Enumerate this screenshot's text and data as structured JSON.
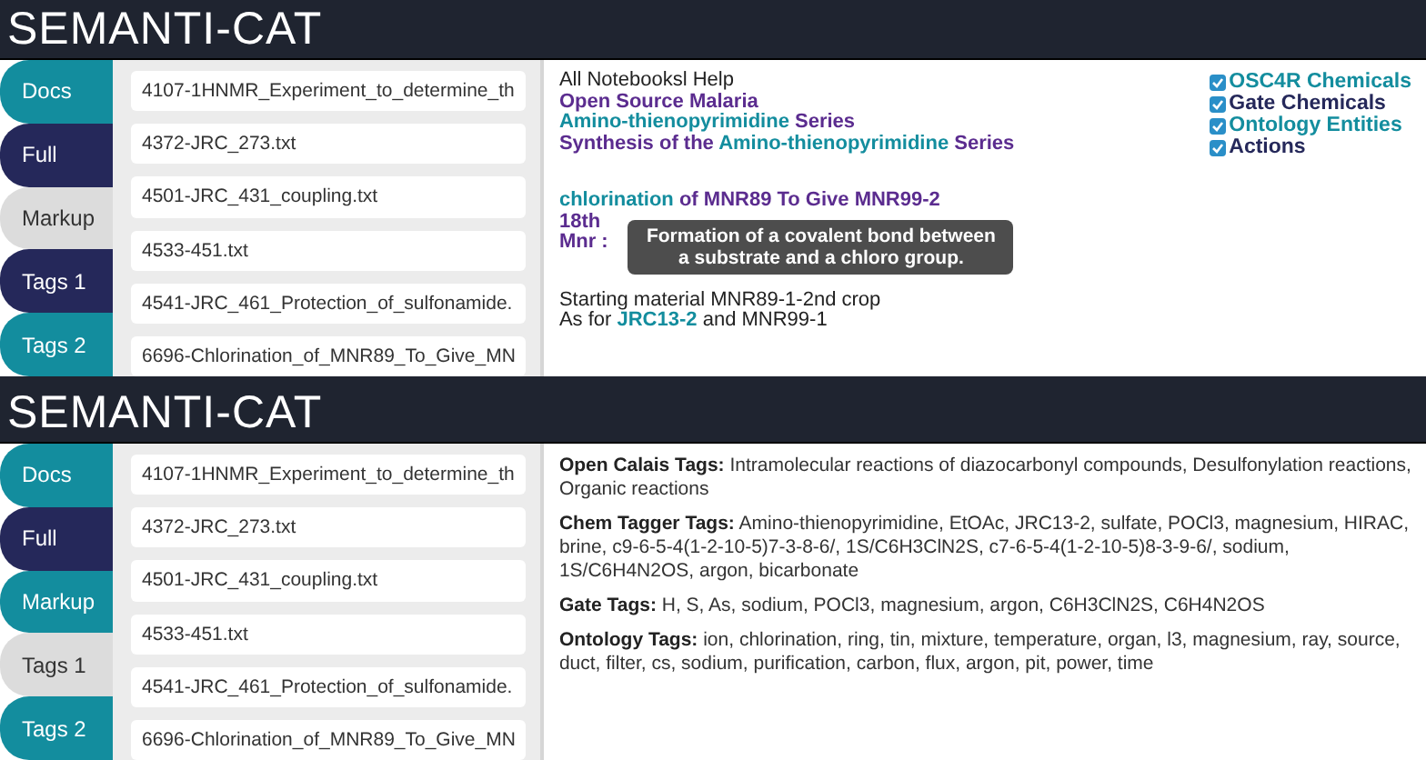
{
  "panels": [
    {
      "brand": "SEMANTI-CAT",
      "tabs": [
        {
          "label": "Docs",
          "color": "#138d9e",
          "selected": false
        },
        {
          "label": "Full",
          "color": "#25285a",
          "selected": false
        },
        {
          "label": "Markup",
          "color": "#dcdcdc",
          "selected": true
        },
        {
          "label": "Tags 1",
          "color": "#25285a",
          "selected": false
        },
        {
          "label": "Tags 2",
          "color": "#138d9e",
          "selected": false
        }
      ],
      "files": [
        "4107-1HNMR_Experiment_to_determine_th",
        "4372-JRC_273.txt",
        "4501-JRC_431_coupling.txt",
        "4533-451.txt",
        "4541-JRC_461_Protection_of_sulfonamide.",
        "6696-Chlorination_of_MNR89_To_Give_MN"
      ],
      "view": {
        "kind": "markup",
        "paragraphs": [
          [
            [
              {
                "kind": "plain",
                "text": "All Notebooksl Help"
              }
            ],
            [
              {
                "kind": "link",
                "text": "Open Source Malaria"
              }
            ],
            [
              {
                "kind": "term",
                "text": "Amino-thienopyrimidine"
              },
              {
                "kind": "link",
                "text": " Series"
              }
            ],
            [
              {
                "kind": "link",
                "text": "Synthesis of the "
              },
              {
                "kind": "term",
                "text": "Amino-thienopyrimidine"
              },
              {
                "kind": "link",
                "text": " Series"
              }
            ]
          ],
          [
            [
              {
                "kind": "term",
                "text": "chlorination"
              },
              {
                "kind": "link",
                "text": " of MNR89 To Give MNR99-2"
              }
            ],
            [
              {
                "kind": "link",
                "text": "18th"
              }
            ],
            [
              {
                "kind": "link",
                "text": "Mnr :"
              }
            ]
          ],
          [
            [
              {
                "kind": "plain",
                "text": "Starting material MNR89-1-2nd crop"
              }
            ],
            [
              {
                "kind": "plain",
                "text": "As for "
              },
              {
                "kind": "term",
                "text": "JRC13-2"
              },
              {
                "kind": "plain",
                "text": " and MNR99-1"
              }
            ]
          ]
        ],
        "tooltip": "Formation of a covalent bond between a substrate and a chloro group.",
        "filters": [
          {
            "label": "OSC4R Chemicals",
            "color": "#138d9e",
            "checked": true
          },
          {
            "label": "Gate Chemicals",
            "color": "#25285a",
            "checked": true
          },
          {
            "label": "Ontology Entities",
            "color": "#138d9e",
            "checked": true
          },
          {
            "label": "Actions",
            "color": "#25285a",
            "checked": true
          }
        ]
      }
    },
    {
      "brand": "SEMANTI-CAT",
      "tabs": [
        {
          "label": "Docs",
          "color": "#138d9e",
          "selected": false
        },
        {
          "label": "Full",
          "color": "#25285a",
          "selected": false
        },
        {
          "label": "Markup",
          "color": "#138d9e",
          "selected": false
        },
        {
          "label": "Tags 1",
          "color": "#dcdcdc",
          "selected": true
        },
        {
          "label": "Tags 2",
          "color": "#138d9e",
          "selected": false
        }
      ],
      "files": [
        "4107-1HNMR_Experiment_to_determine_th",
        "4372-JRC_273.txt",
        "4501-JRC_431_coupling.txt",
        "4533-451.txt",
        "4541-JRC_461_Protection_of_sulfonamide.",
        "6696-Chlorination_of_MNR89_To_Give_MN"
      ],
      "view": {
        "kind": "tags",
        "groups": [
          {
            "label": "Open Calais Tags:",
            "text": "Intramolecular reactions of diazocarbonyl compounds, Desulfonylation reactions, Organic reactions"
          },
          {
            "label": "Chem Tagger Tags:",
            "text": "Amino-thienopyrimidine, EtOAc, JRC13-2, sulfate, POCl3, magnesium, HIRAC, brine, c9-6-5-4(1-2-10-5)7-3-8-6/, 1S/C6H3ClN2S, c7-6-5-4(1-2-10-5)8-3-9-6/, sodium, 1S/C6H4N2OS, argon, bicarbonate"
          },
          {
            "label": "Gate Tags:",
            "text": "H, S, As, sodium, POCl3, magnesium, argon, C6H3ClN2S, C6H4N2OS"
          },
          {
            "label": "Ontology Tags:",
            "text": "ion, chlorination, ring, tin, mixture, temperature, organ, l3, magnesium, ray, source, duct, filter, cs, sodium, purification, carbon, flux, argon, pit, power, time"
          }
        ]
      }
    }
  ]
}
